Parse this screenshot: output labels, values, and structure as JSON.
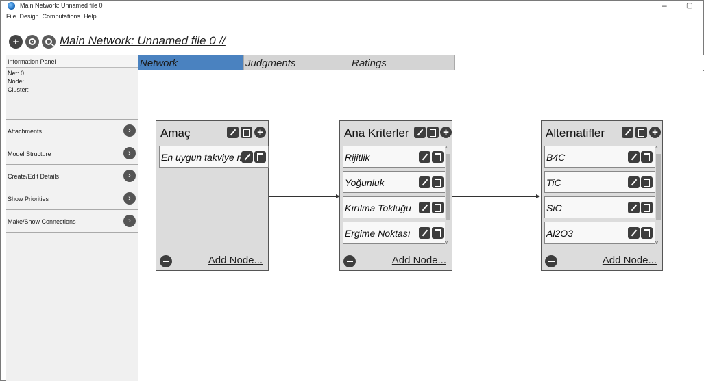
{
  "window": {
    "title": "Main Network: Unnamed file 0",
    "minimize_glyph": "–",
    "maximize_glyph": "▢"
  },
  "menu": [
    "File",
    "Design",
    "Computations",
    "Help"
  ],
  "toolbar": {
    "title": "Main Network: Unnamed file 0 //"
  },
  "sidebar": {
    "header": "Information Panel",
    "net": "Net: 0",
    "node": "Node:",
    "cluster": "Cluster:",
    "items": [
      {
        "label": "Attachments"
      },
      {
        "label": "Model Structure"
      },
      {
        "label": "Create/Edit Details"
      },
      {
        "label": "Show Priorities"
      },
      {
        "label": "Make/Show Connections"
      }
    ]
  },
  "tabs": [
    {
      "label": "Network",
      "active": true
    },
    {
      "label": "Judgments",
      "active": false
    },
    {
      "label": "Ratings",
      "active": false
    }
  ],
  "clusters": [
    {
      "title": "Amaç",
      "nodes": [
        "En uygun takviye m"
      ],
      "add_label": "Add Node..."
    },
    {
      "title": "Ana Kriterler",
      "nodes": [
        "Rijitlik",
        "Yoğunluk",
        "Kırılma Tokluğu",
        "Ergime Noktası"
      ],
      "add_label": "Add Node..."
    },
    {
      "title": "Alternatifler",
      "nodes": [
        "B4C",
        "TiC",
        "SiC",
        "Al2O3"
      ],
      "add_label": "Add Node..."
    }
  ],
  "colors": {
    "active_tab": "#4a82c0",
    "inactive_tab": "#d4d4d4",
    "cluster_bg": "#dcdcdc",
    "icon_dark": "#3d3d3d"
  }
}
